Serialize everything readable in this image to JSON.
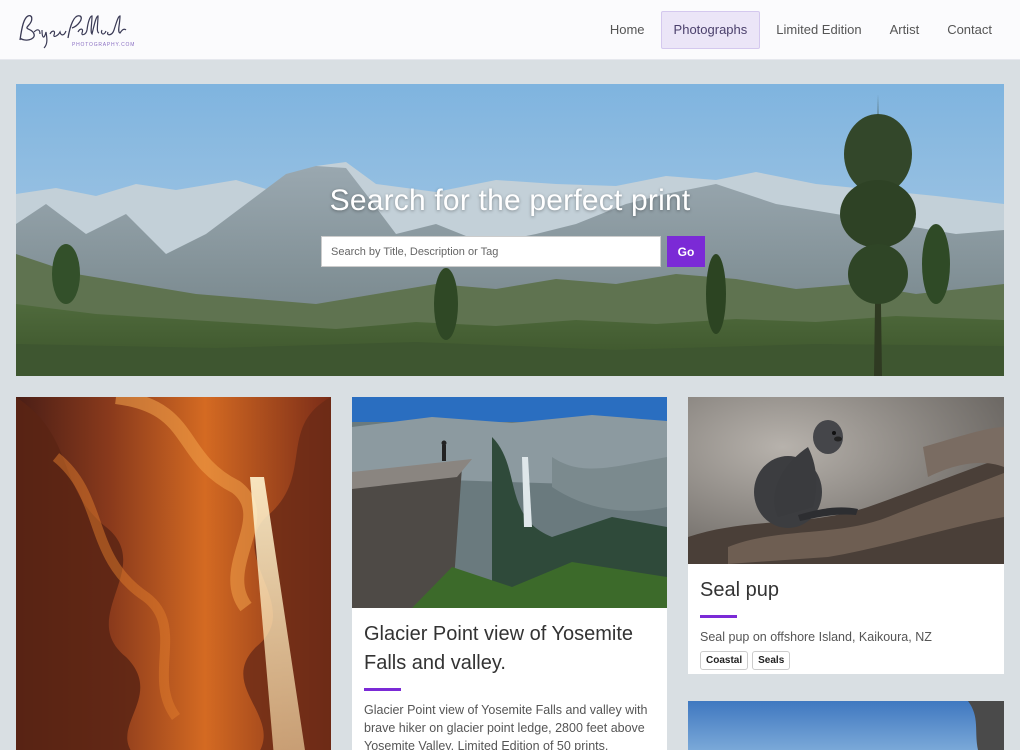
{
  "header": {
    "logo_text": "Bryan Pollock",
    "logo_sub": "PHOTOGRAPHY.COM",
    "nav": [
      {
        "label": "Home",
        "active": false
      },
      {
        "label": "Photographs",
        "active": true
      },
      {
        "label": "Limited Edition",
        "active": false
      },
      {
        "label": "Artist",
        "active": false
      },
      {
        "label": "Contact",
        "active": false
      }
    ]
  },
  "hero": {
    "title": "Search for the perfect print",
    "search_placeholder": "Search by Title, Description or Tag",
    "search_value": "",
    "go_label": "Go"
  },
  "cards": [
    {
      "image": "antelope-canyon-photo",
      "title": "",
      "description": "",
      "tags": []
    },
    {
      "image": "glacier-point-photo",
      "title": "Glacier Point view of Yosemite Falls and valley.",
      "description": "Glacier Point view of Yosemite Falls and valley with brave hiker on glacier point ledge, 2800 feet above Yosemite Valley. Limited Edition of 50 prints.",
      "tags": []
    },
    {
      "image": "seal-pup-photo",
      "title": "Seal pup",
      "description": "Seal pup on offshore Island, Kaikoura, NZ",
      "tags": [
        "Coastal",
        "Seals"
      ]
    },
    {
      "image": "sky-cliff-photo",
      "title": "",
      "description": "",
      "tags": []
    }
  ],
  "colors": {
    "accent": "#7b2ad6",
    "page_bg": "#d9dfe3",
    "nav_active_bg": "#ebe5f7"
  }
}
